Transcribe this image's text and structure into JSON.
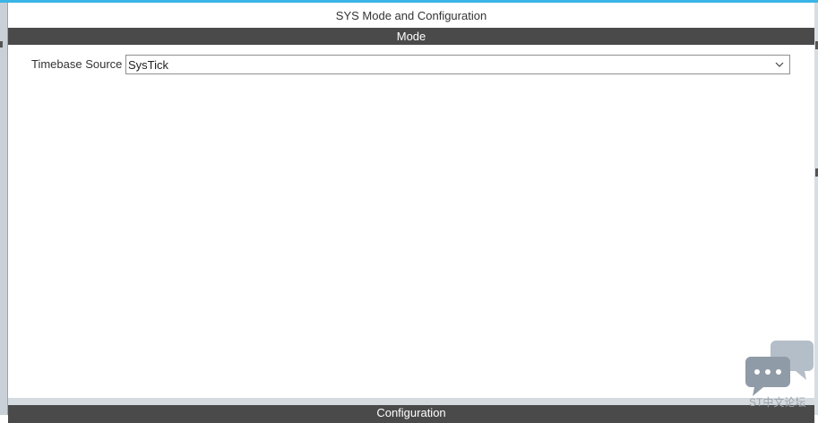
{
  "window": {
    "title": "SYS Mode and Configuration"
  },
  "mode_section": {
    "header": "Mode",
    "timebase_source": {
      "label": "Timebase Source",
      "value": "SysTick"
    }
  },
  "configuration_section": {
    "header": "Configuration"
  },
  "chat_widget": {
    "caption": "ST中文论坛",
    "icon": "chat-bubbles-icon"
  },
  "colors": {
    "accent": "#3ab4e6",
    "section_bar": "#4a4a4a"
  }
}
